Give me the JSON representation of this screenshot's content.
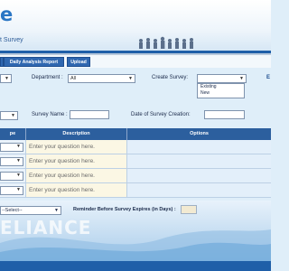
{
  "header": {
    "logo_letter": "e",
    "subtitle": "t Survey"
  },
  "tabs": {
    "daily_analysis": "Daily Analysis Report",
    "upload": "Upload"
  },
  "filters": {
    "department_label": "Department :",
    "department_value": "All",
    "create_survey_label": "Create Survey:",
    "create_survey_options": [
      "Existing",
      "New"
    ],
    "edge_hint": "E"
  },
  "survey": {
    "name_label": "Survey Name :",
    "creation_date_label": "Date of Survey Creation:"
  },
  "grid": {
    "col_type": "pe",
    "col_description": "Description",
    "col_options": "Options",
    "rows": [
      {
        "placeholder": "Enter your question here."
      },
      {
        "placeholder": "Enter your question here."
      },
      {
        "placeholder": "Enter your question here."
      },
      {
        "placeholder": "Enter your question here."
      }
    ]
  },
  "footer": {
    "select_value": "--Select--",
    "reminder_label": "Reminder Before Survey Expires (in Days) :",
    "watermark": "ELIANCE"
  }
}
